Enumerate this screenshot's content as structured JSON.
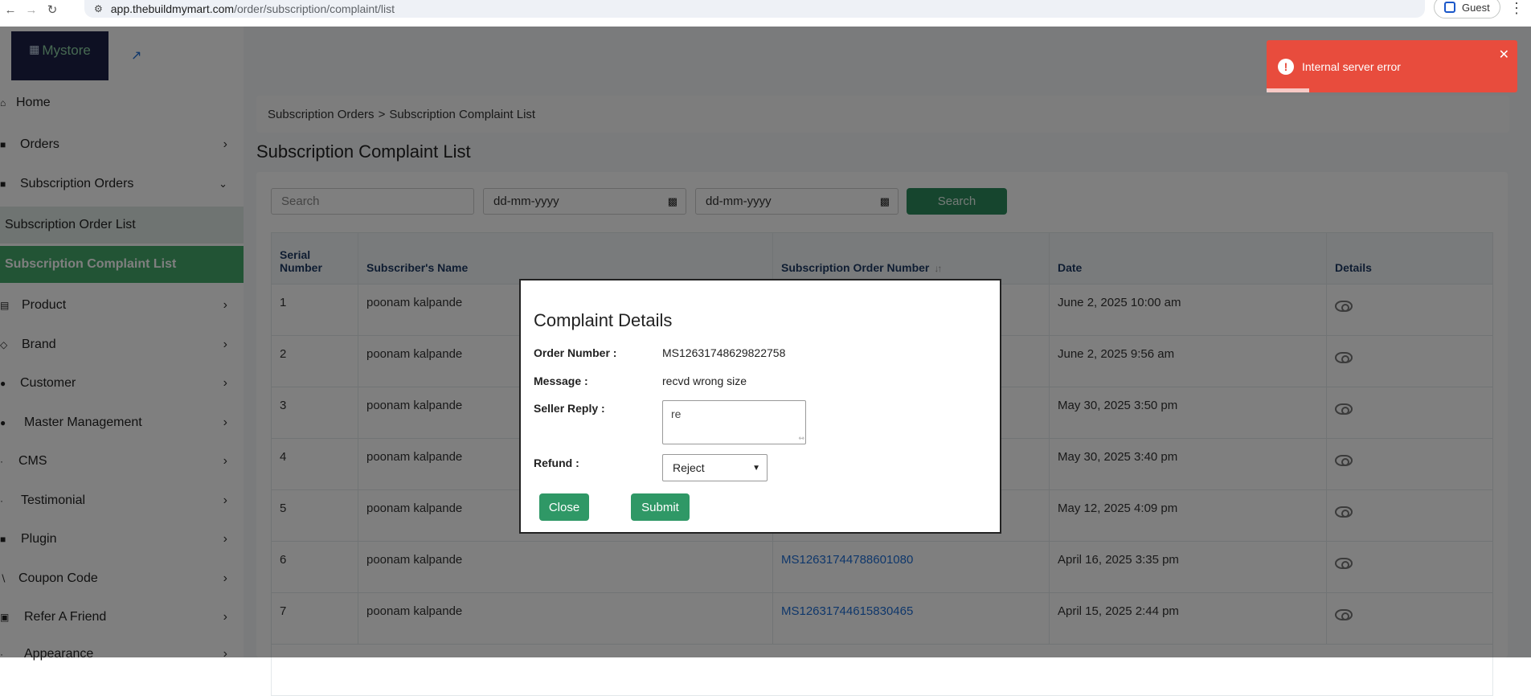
{
  "browser": {
    "back_icon": "back-arrow-icon",
    "forward_icon": "forward-arrow-icon",
    "reload_icon": "reload-icon",
    "url_domain": "app.thebuildmymart.com",
    "url_path": "/order/subscription/complaint/list",
    "profile_label": "Guest"
  },
  "sidebar": {
    "logo_text": "Mystore",
    "items": [
      {
        "label": "Home"
      },
      {
        "label": "Orders"
      },
      {
        "label": "Subscription Orders"
      },
      {
        "label": "Subscription Order List"
      },
      {
        "label": "Subscription Complaint List"
      },
      {
        "label": "Product"
      },
      {
        "label": "Brand"
      },
      {
        "label": "Customer"
      },
      {
        "label": "Master Management"
      },
      {
        "label": "CMS"
      },
      {
        "label": "Testimonial"
      },
      {
        "label": "Plugin"
      },
      {
        "label": "Coupon Code"
      },
      {
        "label": "Refer A Friend"
      },
      {
        "label": "Appearance"
      }
    ]
  },
  "breadcrumb": {
    "parent": "Subscription Orders",
    "separator": ">",
    "current": "Subscription Complaint List"
  },
  "page_title": "Subscription Complaint List",
  "filters": {
    "search_placeholder": "Search",
    "date_from": "dd-mm-yyyy",
    "date_to": "dd-mm-yyyy",
    "search_button": "Search"
  },
  "table": {
    "headers": {
      "serial_line1": "Serial",
      "serial_line2": "Number",
      "name": "Subscriber's Name",
      "order_number": "Subscription Order Number",
      "date": "Date",
      "details": "Details"
    },
    "rows": [
      {
        "serial": "1",
        "name": "poonam kalpande",
        "order": "",
        "date": "June 2, 2025 10:00 am"
      },
      {
        "serial": "2",
        "name": "poonam kalpande",
        "order": "",
        "date": "June 2, 2025 9:56 am"
      },
      {
        "serial": "3",
        "name": "poonam kalpande",
        "order": "",
        "date": "May 30, 2025 3:50 pm"
      },
      {
        "serial": "4",
        "name": "poonam kalpande",
        "order": "",
        "date": "May 30, 2025 3:40 pm"
      },
      {
        "serial": "5",
        "name": "poonam kalpande",
        "order": "",
        "date": "May 12, 2025 4:09 pm"
      },
      {
        "serial": "6",
        "name": "poonam kalpande",
        "order": "MS12631744788601080",
        "date": "April 16, 2025 3:35 pm"
      },
      {
        "serial": "7",
        "name": "poonam kalpande",
        "order": "MS12631744615830465",
        "date": "April 15, 2025 2:44 pm"
      }
    ]
  },
  "modal": {
    "title": "Complaint Details",
    "order_label": "Order Number :",
    "order_value": "MS12631748629822758",
    "message_label": "Message :",
    "message_value": "recvd wrong size",
    "reply_label": "Seller Reply :",
    "reply_value": "re",
    "refund_label": "Refund :",
    "refund_value": "Reject",
    "close_button": "Close",
    "submit_button": "Submit"
  },
  "toast": {
    "message": "Internal server error",
    "color": "#e84c3d"
  },
  "colors": {
    "brand_green": "#2d8b5c",
    "active_nav": "#45a86a",
    "logo_bg": "#1c2147",
    "link": "#1f6fd6"
  }
}
